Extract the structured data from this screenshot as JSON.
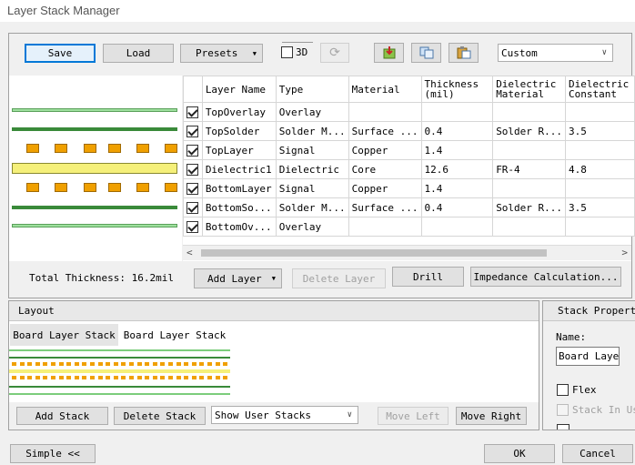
{
  "window": {
    "title": "Layer Stack Manager"
  },
  "toolbar": {
    "save_label": "Save",
    "load_label": "Load",
    "presets_label": "Presets",
    "threed_label": "3D",
    "preset_select": "Custom"
  },
  "table": {
    "headers": [
      "Layer Name",
      "Type",
      "Material",
      "Thickness (mil)",
      "Dielectric Material",
      "Dielectric Constant"
    ],
    "rows": [
      {
        "checked": true,
        "name": "TopOverlay",
        "type": "Overlay",
        "material": "",
        "thickness": "",
        "dmat": "",
        "dconst": ""
      },
      {
        "checked": true,
        "name": "TopSolder",
        "type": "Solder M...",
        "material": "Surface ...",
        "thickness": "0.4",
        "dmat": "Solder R...",
        "dconst": "3.5"
      },
      {
        "checked": true,
        "name": "TopLayer",
        "type": "Signal",
        "material": "Copper",
        "thickness": "1.4",
        "dmat": "",
        "dconst": ""
      },
      {
        "checked": true,
        "name": "Dielectric1",
        "type": "Dielectric",
        "material": "Core",
        "thickness": "12.6",
        "dmat": "FR-4",
        "dconst": "4.8"
      },
      {
        "checked": true,
        "name": "BottomLayer",
        "type": "Signal",
        "material": "Copper",
        "thickness": "1.4",
        "dmat": "",
        "dconst": ""
      },
      {
        "checked": true,
        "name": "BottomSo...",
        "type": "Solder M...",
        "material": "Surface ...",
        "thickness": "0.4",
        "dmat": "Solder R...",
        "dconst": "3.5"
      },
      {
        "checked": true,
        "name": "BottomOv...",
        "type": "Overlay",
        "material": "",
        "thickness": "",
        "dmat": "",
        "dconst": ""
      }
    ]
  },
  "stack_info": {
    "total_thickness": "Total Thickness: 16.2mil",
    "add_layer": "Add Layer",
    "delete_layer": "Delete Layer",
    "drill": "Drill",
    "impedance": "Impedance Calculation..."
  },
  "layout": {
    "header": "Layout",
    "tab1": "Board Layer Stack",
    "tab2": "Board Layer Stack",
    "add_stack": "Add Stack",
    "delete_stack": "Delete Stack",
    "show_user_stacks": "Show User Stacks",
    "move_left": "Move Left",
    "move_right": "Move Right"
  },
  "properties": {
    "header": "Stack Propert",
    "name_label": "Name:",
    "name_value": "Board Laye",
    "flex_label": "Flex",
    "stack_in_use_label": "Stack In Us"
  },
  "footer": {
    "simple": "Simple <<",
    "ok": "OK",
    "cancel": "Cancel"
  },
  "colors": {
    "overlay": "#7ccd7c",
    "solder": "#3a8a3a",
    "copper_pad": "#f0a000",
    "dielectric": "#f5f07a",
    "accent": "#0078d7"
  }
}
